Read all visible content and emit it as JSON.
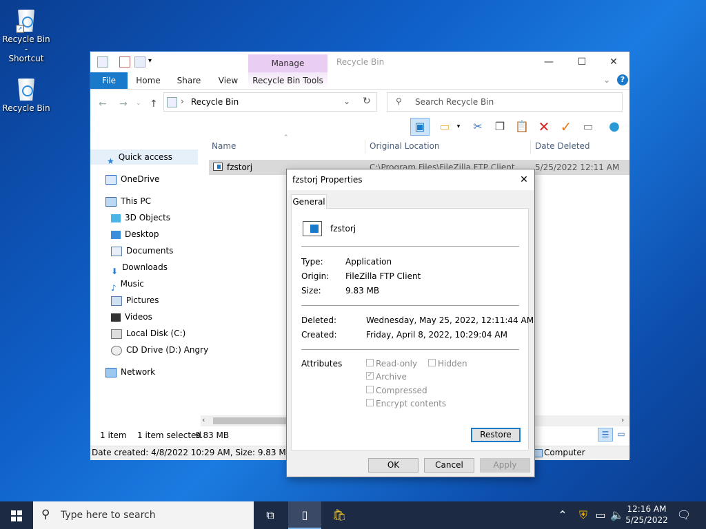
{
  "desktop": {
    "icons": [
      {
        "label_line1": "Recycle Bin -",
        "label_line2": "Shortcut"
      },
      {
        "label_line1": "Recycle Bin",
        "label_line2": ""
      }
    ]
  },
  "explorer": {
    "title": "Recycle Bin",
    "manage_tab": "Manage",
    "tabs": {
      "file": "File",
      "home": "Home",
      "share": "Share",
      "view": "View",
      "tools": "Recycle Bin Tools"
    },
    "address": "Recycle Bin",
    "search_placeholder": "Search Recycle Bin",
    "columns": {
      "name": "Name",
      "original_location": "Original Location",
      "date_deleted": "Date Deleted"
    },
    "rows": [
      {
        "name": "fzstorj",
        "original_location": "C:\\Program Files\\FileZilla FTP Client",
        "date_deleted": "5/25/2022 12:11 AM"
      }
    ],
    "nav": {
      "quick_access": "Quick access",
      "onedrive": "OneDrive",
      "this_pc": "This PC",
      "objects3d": "3D Objects",
      "desktop": "Desktop",
      "documents": "Documents",
      "downloads": "Downloads",
      "music": "Music",
      "pictures": "Pictures",
      "videos": "Videos",
      "local_disk": "Local Disk (C:)",
      "cd_drive": "CD Drive (D:) Angry",
      "network": "Network"
    },
    "status": {
      "count": "1 item",
      "selected": "1 item selected",
      "size": "9.83 MB"
    },
    "details": "Date created: 4/8/2022 10:29 AM, Size: 9.83 MB, Origin",
    "details_right": "Computer"
  },
  "dialog": {
    "title": "fzstorj Properties",
    "tab": "General",
    "filename": "fzstorj",
    "type_label": "Type:",
    "type_value": "Application",
    "origin_label": "Origin:",
    "origin_value": "FileZilla FTP Client",
    "size_label": "Size:",
    "size_value": "9.83 MB",
    "deleted_label": "Deleted:",
    "deleted_value": "Wednesday, May 25, 2022, 12:11:44 AM",
    "created_label": "Created:",
    "created_value": "Friday, April 8, 2022, 10:29:04 AM",
    "attributes_label": "Attributes",
    "attr": {
      "readonly": "Read-only",
      "hidden": "Hidden",
      "archive": "Archive",
      "compressed": "Compressed",
      "encrypt": "Encrypt contents"
    },
    "restore": "Restore",
    "ok": "OK",
    "cancel": "Cancel",
    "apply": "Apply"
  },
  "taskbar": {
    "search_placeholder": "Type here to search",
    "time": "12:16 AM",
    "date": "5/25/2022"
  }
}
